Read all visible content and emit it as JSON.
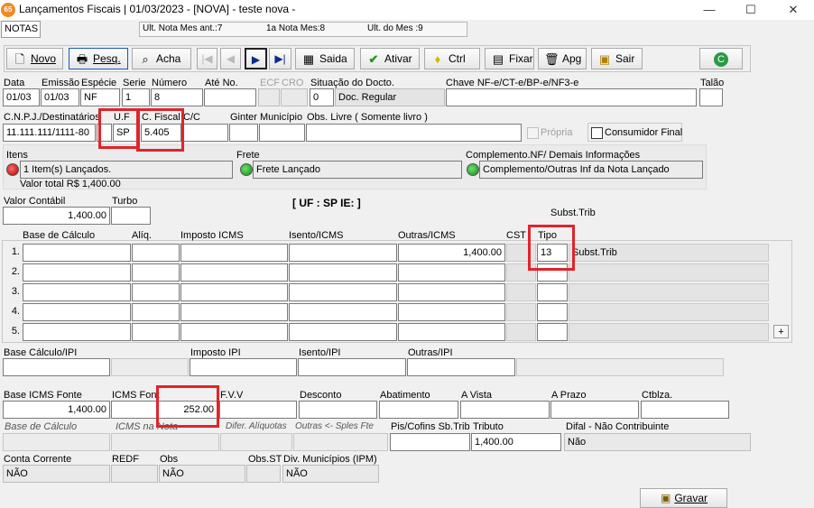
{
  "window": {
    "title": "Lançamentos Fiscais | 01/03/2023 - [NOVA] - teste nova -",
    "app_icon_text": "65",
    "minimize": "—",
    "maximize": "☐",
    "close": "✕"
  },
  "topbar": {
    "tab_label": "NOTAS",
    "ult_nota_mes_ant_label": "Ult. Nota Mes ant.:",
    "ult_nota_mes_ant_value": "7",
    "primeira_nota_mes_label": "1a Nota Mes:",
    "primeira_nota_mes_value": "8",
    "ult_do_mes_label": "Ult. do Mes :",
    "ult_do_mes_value": "9"
  },
  "toolbar": {
    "novo": "Novo",
    "pesq": "Pesq.",
    "acha": "Acha",
    "saida": "Saida",
    "ativar": "Ativar",
    "ctrl": "Ctrl",
    "fixar": "Fixar",
    "apg": "Apg",
    "sair": "Sair"
  },
  "header": {
    "data_label": "Data",
    "data_value": "01/03",
    "emissao_label": "Emissão",
    "emissao_value": "01/03",
    "especie_label": "Espécie",
    "especie_value": "NF",
    "serie_label": "Serie",
    "serie_value": "1",
    "numero_label": "Número",
    "numero_value": "8",
    "ate_no_label": "Até No.",
    "ate_no_value": "",
    "ecf_label": "ECF",
    "cro_label": "CRO",
    "situacao_label": "Situação do Docto.",
    "situacao_code": "0",
    "situacao_desc": "Doc. Regular",
    "chave_label": "Chave NF-e/CT-e/BP-e/NF3-e",
    "chave_value": "",
    "talao_label": "Talão",
    "talao_value": ""
  },
  "dest": {
    "cnpj_label": "C.N.P.J./Destinatários",
    "cnpj_value": "11.111.111/1111-80",
    "uf_label": "U.F",
    "uf_value": "SP",
    "cfiscal_label": "C. Fiscal",
    "cfiscal_value": "5.405",
    "cc_label": "C/C",
    "ginter_label": "Ginter",
    "municipio_label": "Município",
    "obs_livre_label": "Obs. Livre ( Somente livro )",
    "propria_label": "Própria",
    "consumidor_final_label": "Consumidor Final"
  },
  "itens": {
    "itens_label": "Itens",
    "itens_value": "1 Item(s) Lançados.",
    "valor_total": "Valor total R$ 1,400.00",
    "frete_label": "Frete",
    "frete_value": "Frete Lançado",
    "complemento_label": "Complemento.NF/ Demais Informações",
    "complemento_value": "Complemento/Outras Inf da Nota Lançado"
  },
  "valores": {
    "valor_contabil_label": "Valor Contábil",
    "valor_contabil_value": "1,400.00",
    "turbo_label": "Turbo",
    "uf_ie_text": "[ UF : SP IE: ]",
    "subst_trib_label": "Subst.Trib"
  },
  "icms_grid": {
    "headers": {
      "base": "Base de Cálculo",
      "aliq": "Alíq.",
      "imposto": "Imposto ICMS",
      "isento": "Isento/ICMS",
      "outras": "Outras/ICMS",
      "cst": "CST",
      "tipo": "Tipo"
    },
    "rows": [
      {
        "n": "1.",
        "outras": "1,400.00",
        "tipo": "13",
        "desc": "Subst.Trib"
      },
      {
        "n": "2.",
        "outras": "",
        "tipo": "",
        "desc": ""
      },
      {
        "n": "3.",
        "outras": "",
        "tipo": "",
        "desc": ""
      },
      {
        "n": "4.",
        "outras": "",
        "tipo": "",
        "desc": ""
      },
      {
        "n": "5.",
        "outras": "",
        "tipo": "",
        "desc": ""
      }
    ],
    "add_button": "+"
  },
  "ipi": {
    "base_label": "Base Cálculo/IPI",
    "imposto_label": "Imposto IPI",
    "isento_label": "Isento/IPI",
    "outras_label": "Outras/IPI"
  },
  "st": {
    "base_icms_fonte_label": "Base ICMS Fonte",
    "base_icms_fonte_value": "1,400.00",
    "icms_fonte_label": "ICMS Font",
    "icms_fonte_value": "252.00",
    "fvv_label": "F.V.V",
    "desconto_label": "Desconto",
    "abatimento_label": "Abatimento",
    "a_vista_label": "A Vista",
    "a_prazo_label": "A Prazo",
    "ctblza_label": "Ctblza."
  },
  "extra": {
    "base_calculo_label": "Base de Cálculo",
    "icms_na_nota_label": "ICMS na Nota",
    "difer_aliquotas_label": "Difer. Alíquotas",
    "outras_sples_label": "Outras <- Sples Fte",
    "pis_cofins_label": "Pis/Cofins Sb.Trib",
    "tributo_label": "Tributo",
    "tributo_value": "1,400.00",
    "difal_label": "Difal - Não Contribuinte",
    "difal_value": "Não"
  },
  "footer": {
    "conta_corrente_label": "Conta Corrente",
    "conta_corrente_value": "NÃO",
    "redf_label": "REDF",
    "obs_label": "Obs",
    "obs_value": "NÃO",
    "obs_st_label": "Obs.ST",
    "div_municipios_label": "Div. Municípios (IPM)",
    "div_municipios_value": "NÃO",
    "gravar": "Gravar"
  },
  "colors": {
    "highlight": "#e0242a",
    "app_icon": "#f08a24"
  }
}
